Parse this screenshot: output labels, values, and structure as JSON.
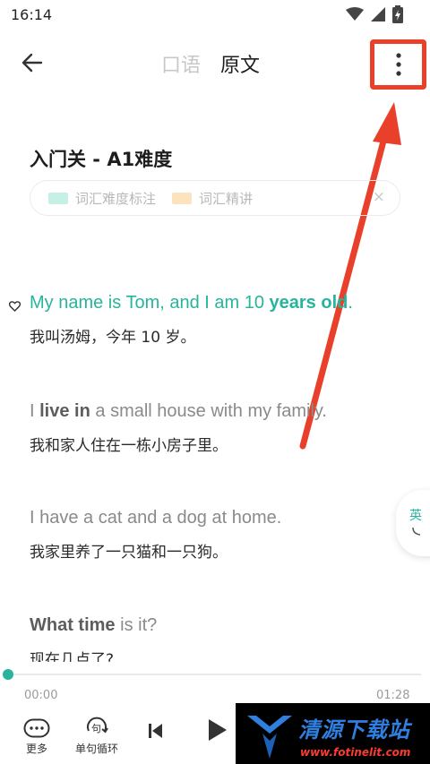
{
  "status_bar": {
    "time": "16:14"
  },
  "header": {
    "tabs": [
      {
        "label": "口语",
        "active": false
      },
      {
        "label": "原文",
        "active": true
      }
    ]
  },
  "lesson": {
    "title": "入门关 - A1难度"
  },
  "legend": {
    "items": [
      {
        "label": "词汇难度标注",
        "color": "#c6f0e6"
      },
      {
        "label": "词汇精讲",
        "color": "#fbe3bd"
      }
    ],
    "close": "×"
  },
  "sentences": [
    {
      "en_parts": [
        "My name is Tom, and I am 10 ",
        "years old",
        "."
      ],
      "zh": "我叫汤姆，今年 10 岁。",
      "active": true
    },
    {
      "en_parts": [
        "I ",
        "live in",
        " a small house with my family."
      ],
      "zh": "我和家人住在一栋小房子里。",
      "active": false
    },
    {
      "en_parts": [
        "I have a cat and a dog at home.",
        "",
        ""
      ],
      "zh": "我家里养了一只猫和一只狗。",
      "active": false
    },
    {
      "en_parts": [
        "",
        "What time",
        " is it?"
      ],
      "zh": "现在几点了?",
      "active": false
    }
  ],
  "side_tab": {
    "label": "英"
  },
  "player": {
    "current_time": "00:00",
    "total_time": "01:28",
    "progress": 0,
    "controls": [
      {
        "label": "更多"
      },
      {
        "label": "单句循环"
      }
    ]
  },
  "watermark": {
    "title": "清源下载站",
    "url": "www.fotinelit.com"
  },
  "colors": {
    "accent": "#26b59c",
    "highlight_box": "#e8402a"
  }
}
